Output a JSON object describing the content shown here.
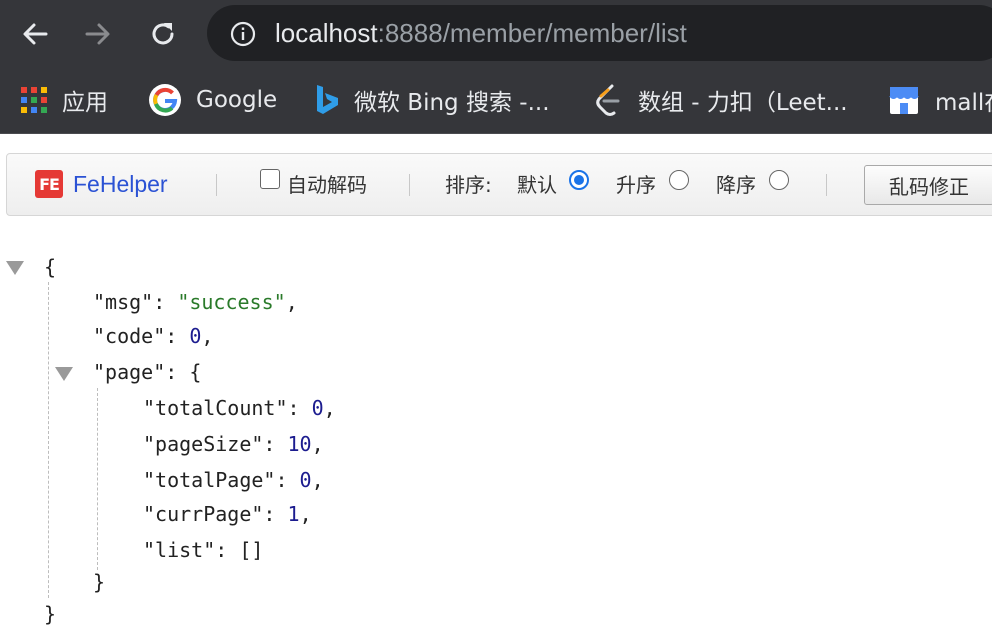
{
  "browser": {
    "url_host": "localhost",
    "url_path": ":8888/member/member/list",
    "icons": {
      "back": "arrow-left-icon",
      "forward": "arrow-right-icon",
      "reload": "reload-icon",
      "site_info": "info-icon"
    },
    "bookmarks": [
      {
        "label": "应用",
        "icon": "apps-grid-icon"
      },
      {
        "label": "Google",
        "icon": "google-logo-icon"
      },
      {
        "label": "微软 Bing 搜索 -...",
        "icon": "bing-logo-icon"
      },
      {
        "label": "数组 - 力扣（Leet...",
        "icon": "leetcode-logo-icon"
      },
      {
        "label": "mall在",
        "icon": "store-icon"
      }
    ]
  },
  "fehelper": {
    "logo_badge": "FE",
    "title": "FeHelper",
    "auto_decode_label": "自动解码",
    "auto_decode_checked": false,
    "sort_label": "排序:",
    "sort_options": [
      {
        "label": "默认",
        "selected": true
      },
      {
        "label": "升序",
        "selected": false
      },
      {
        "label": "降序",
        "selected": false
      }
    ],
    "fix_button_label": "乱码修正"
  },
  "json_view": {
    "open_brace": "{",
    "close_brace": "}",
    "msg_key": "\"msg\"",
    "msg_value": "\"success\"",
    "code_key": "\"code\"",
    "code_value": "0",
    "page_key": "\"page\"",
    "totalCount_key": "\"totalCount\"",
    "totalCount_value": "0",
    "pageSize_key": "\"pageSize\"",
    "pageSize_value": "10",
    "totalPage_key": "\"totalPage\"",
    "totalPage_value": "0",
    "currPage_key": "\"currPage\"",
    "currPage_value": "1",
    "list_key": "\"list\"",
    "list_value": "[]"
  },
  "colors": {
    "chrome_bg": "#35363a",
    "omnibox_bg": "#202124",
    "string_value": "#2a7a2a",
    "number_value": "#1c1c8f",
    "fehelper_title": "#2b52d4"
  }
}
